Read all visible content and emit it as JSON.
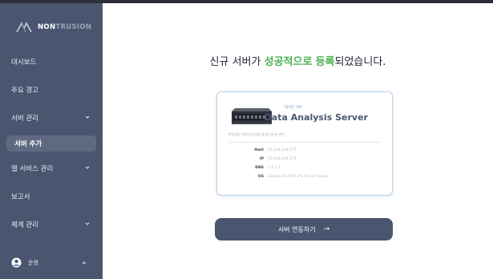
{
  "brand": {
    "part1": "NON",
    "part2": "TRUSION"
  },
  "sidebar": {
    "items": [
      {
        "label": "대시보드",
        "has_chevron": false
      },
      {
        "label": "주요 경고",
        "has_chevron": false
      },
      {
        "label": "서버 관리",
        "has_chevron": true
      },
      {
        "label": "서버 추가",
        "has_chevron": false,
        "active": true
      },
      {
        "label": "웹 서비스 관리",
        "has_chevron": true
      },
      {
        "label": "보고서",
        "has_chevron": false
      },
      {
        "label": "체계 관리",
        "has_chevron": true
      }
    ],
    "user": {
      "label": "운영",
      "icon": "user-circle-icon"
    }
  },
  "headline": {
    "prefix": "신규 서버가 ",
    "hl1": "성공적으로",
    "mid": " ",
    "hl2": "등록",
    "suffix": "되었습니다."
  },
  "card": {
    "tag": "데이터 서버",
    "title": "Data Analysis Server",
    "description": "빈공지능 데이터 분석을 데이터 분석 서버",
    "specs": [
      {
        "key": "Host",
        "value": "63.214.144.175"
      },
      {
        "key": "IP",
        "value": "63.214.144.175"
      },
      {
        "key": "DNS",
        "value": "1.1.1.1"
      },
      {
        "key": "OS",
        "value": "Ubuntu 20.04.5 LTS (Focal Fossa)"
      }
    ]
  },
  "cta": {
    "label": "서버 연동하기",
    "arrow": "→"
  },
  "colors": {
    "sidebar": "#4a5670",
    "accent_green": "#4caf50",
    "button": "#4a5670"
  }
}
